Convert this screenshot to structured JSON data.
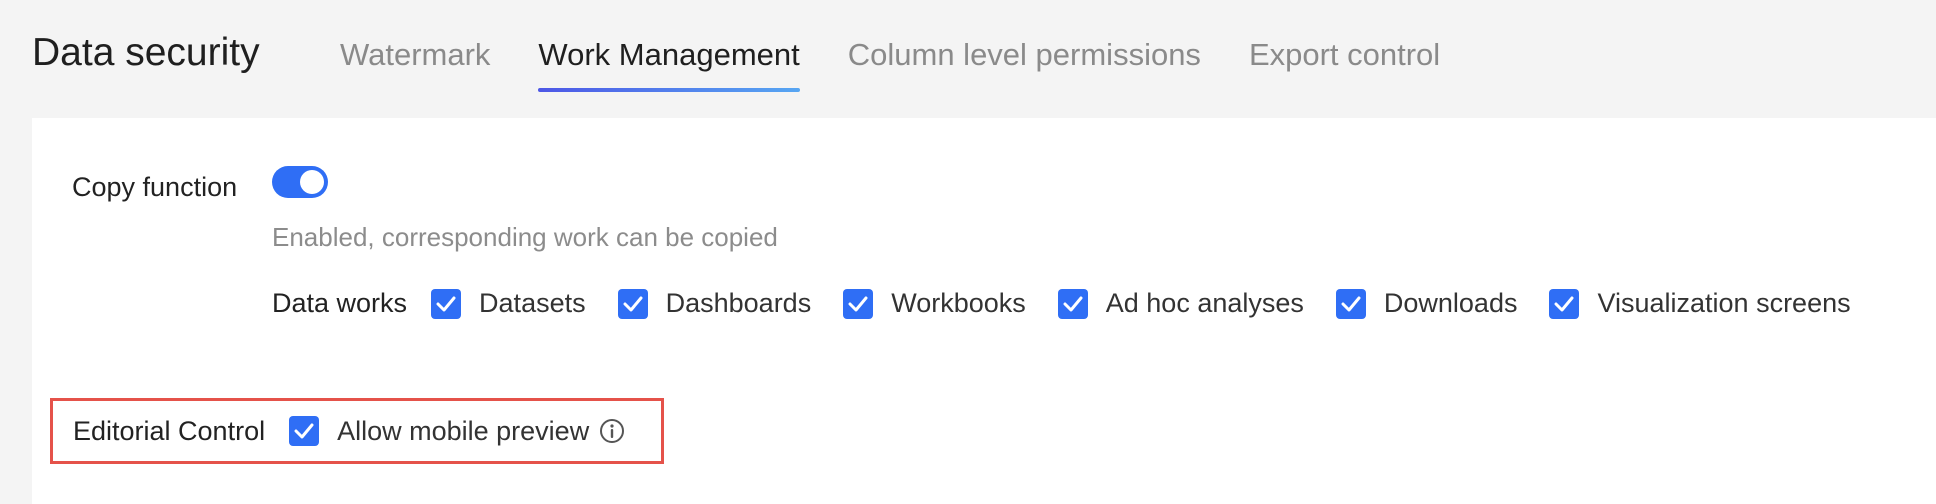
{
  "page_title": "Data security",
  "tabs": [
    {
      "label": "Watermark",
      "active": false
    },
    {
      "label": "Work Management",
      "active": true
    },
    {
      "label": "Column level permissions",
      "active": false
    },
    {
      "label": "Export control",
      "active": false
    }
  ],
  "copy_function": {
    "label": "Copy function",
    "enabled": true,
    "hint": "Enabled, corresponding work can be copied"
  },
  "data_works": {
    "label": "Data works",
    "items": [
      {
        "label": "Datasets",
        "checked": true
      },
      {
        "label": "Dashboards",
        "checked": true
      },
      {
        "label": "Workbooks",
        "checked": true
      },
      {
        "label": "Ad hoc analyses",
        "checked": true
      },
      {
        "label": "Downloads",
        "checked": true
      },
      {
        "label": "Visualization screens",
        "checked": true
      }
    ]
  },
  "editorial_control": {
    "label": "Editorial Control",
    "option_label": "Allow mobile preview",
    "checked": true,
    "info_icon": "info-circle-icon"
  },
  "colors": {
    "accent": "#2f6ef5",
    "highlight_border": "#e5524a",
    "tab_underline_start": "#4d57e6",
    "tab_underline_end": "#57a6f2"
  }
}
